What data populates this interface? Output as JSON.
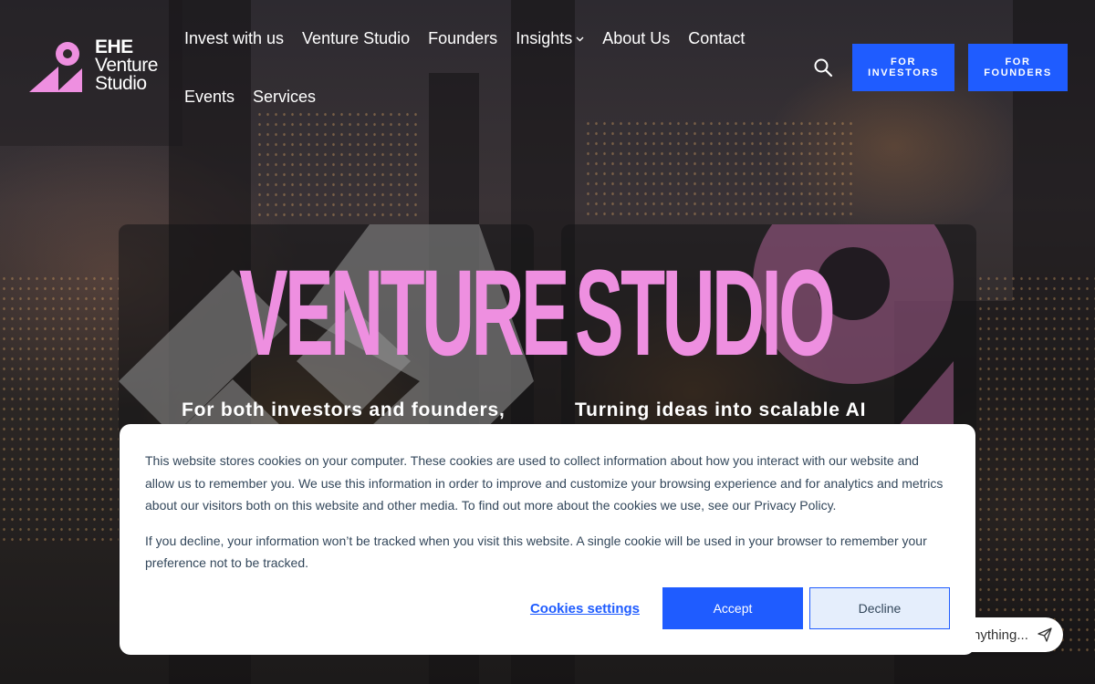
{
  "brand": {
    "line1": "EHE",
    "line2": "Venture",
    "line3": "Studio",
    "pink": "#ee8fe0",
    "blue": "#1f5cff"
  },
  "nav": {
    "row1": [
      "Invest with us",
      "Venture Studio",
      "Founders",
      "Insights",
      "About Us",
      "Contact"
    ],
    "row2": [
      "Events",
      "Services"
    ],
    "insights_icon": "chevron-down-icon"
  },
  "header": {
    "search_icon": "search-icon",
    "cta_investors_l1": "FOR",
    "cta_investors_l2": "INVESTORS",
    "cta_founders_l1": "FOR",
    "cta_founders_l2": "FOUNDERS"
  },
  "hero": {
    "word1": "VENTURE",
    "word2": "STUDIO",
    "sub_left": "For both investors and founders,",
    "sub_right": "Turning ideas into scalable AI"
  },
  "cookie": {
    "p1": "This website stores cookies on your computer. These cookies are used to collect information about how you interact with our website and allow us to remember you. We use this information in order to improve and customize your browsing experience and for analytics and metrics about our visitors both on this website and other media. To find out more about the cookies we use, see our Privacy Policy.",
    "p2": "If you decline, your information won’t be tracked when you visit this website. A single cookie will be used in your browser to remember your preference not to be tracked.",
    "settings_label": "Cookies settings",
    "accept_label": "Accept",
    "decline_label": "Decline"
  },
  "chat": {
    "text": "nything...",
    "icon": "send-icon"
  }
}
